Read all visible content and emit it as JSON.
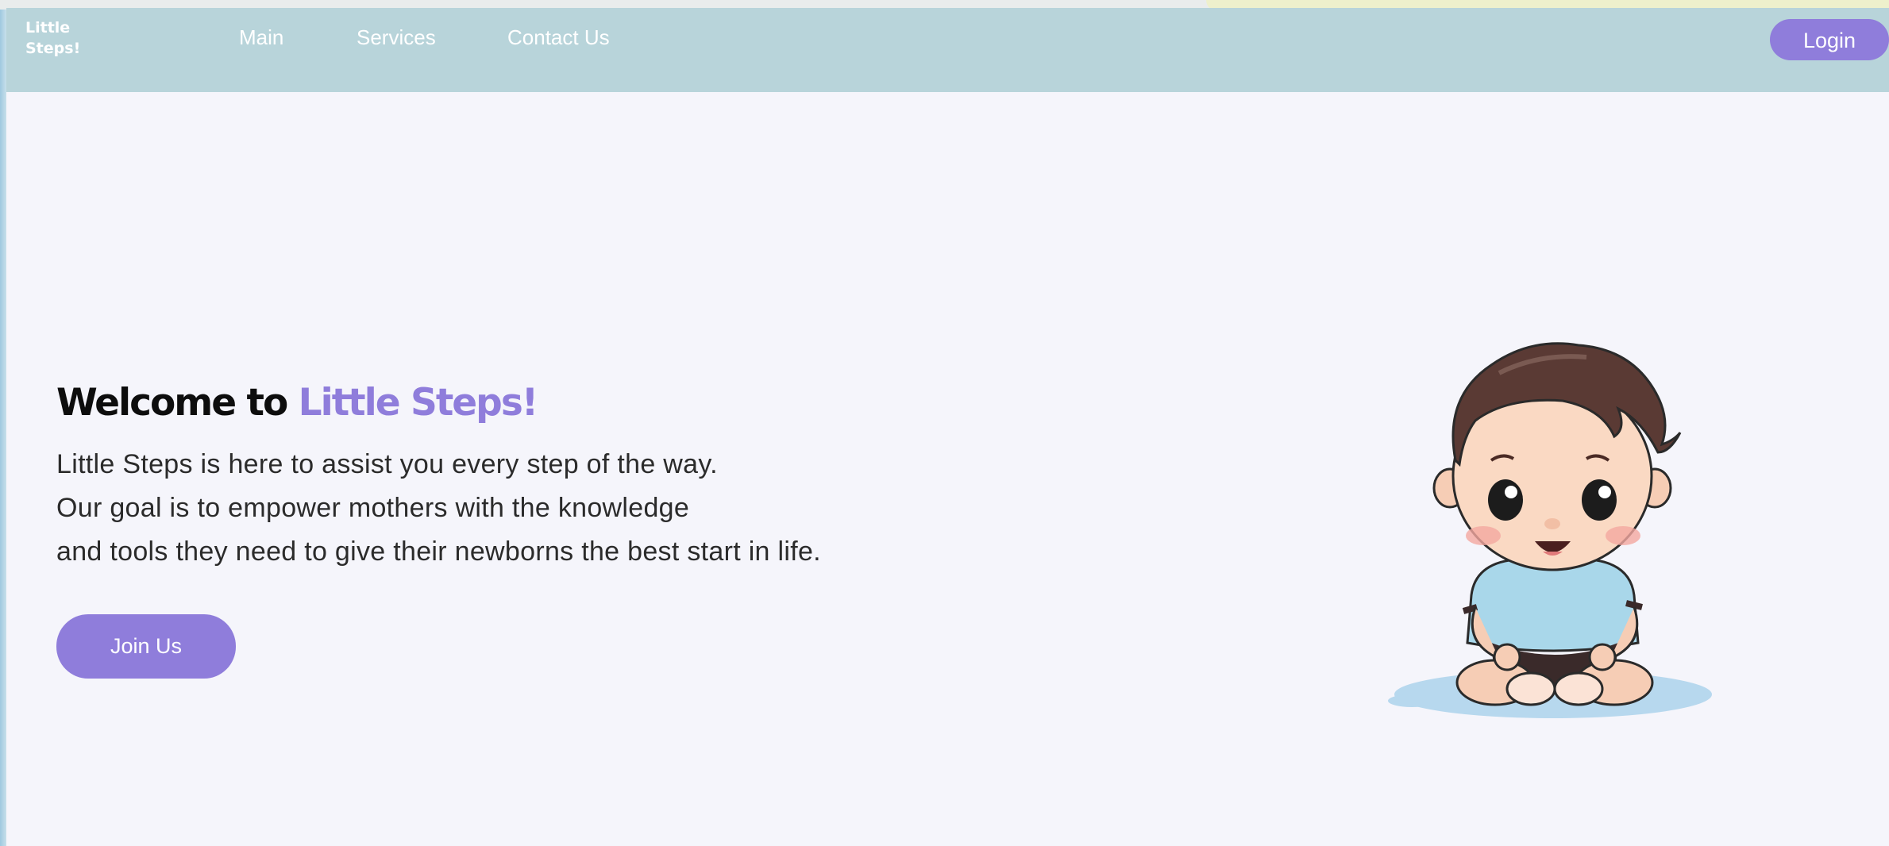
{
  "header": {
    "logo_line1": "Little",
    "logo_line2": "Steps!",
    "nav": [
      {
        "label": "Main"
      },
      {
        "label": "Services"
      },
      {
        "label": "Contact Us"
      }
    ],
    "login_label": "Login"
  },
  "hero": {
    "title_prefix": "Welcome to ",
    "title_brand": "Little Steps!",
    "lines": [
      "Little Steps is here to assist you every step of the way.",
      "Our goal is to empower mothers with the knowledge",
      "and tools they need to give their newborns the best start in life."
    ],
    "cta_label": "Join Us"
  },
  "illustration": {
    "icon": "baby-illustration"
  },
  "colors": {
    "navbar": "#b8d4da",
    "accent": "#8f7ddb",
    "page_bg": "#f5f5fb"
  }
}
